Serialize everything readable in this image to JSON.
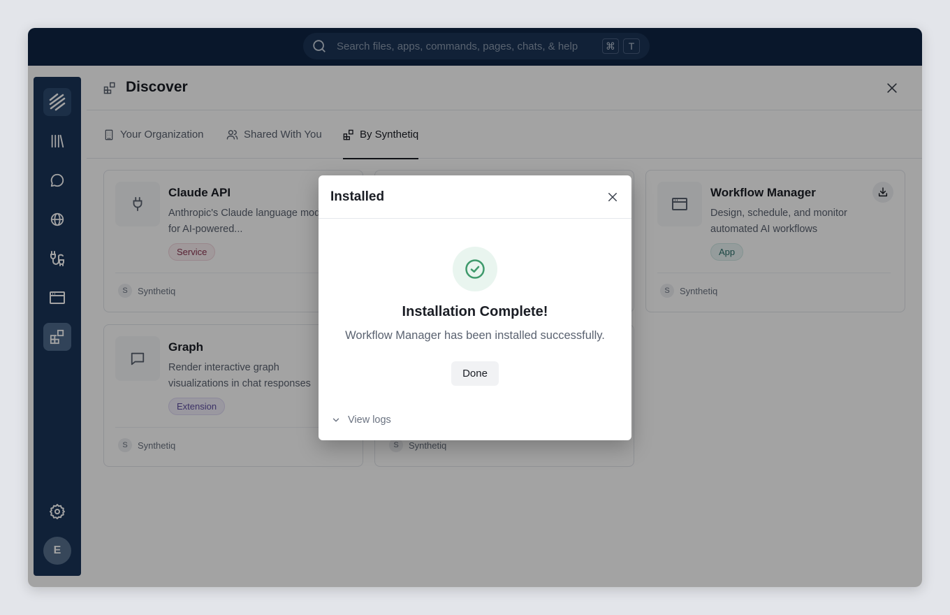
{
  "search": {
    "placeholder": "Search files, apps, commands, pages, chats, & help",
    "shortcut_keys": [
      "⌘",
      "T"
    ]
  },
  "sidebar": {
    "items": [
      {
        "name": "logo",
        "icon": "stripes-logo-icon"
      },
      {
        "name": "library",
        "icon": "library-icon"
      },
      {
        "name": "chats",
        "icon": "chat-bubble-icon"
      },
      {
        "name": "web",
        "icon": "globe-icon"
      },
      {
        "name": "integrations",
        "icon": "plug-cable-icon"
      },
      {
        "name": "apps",
        "icon": "window-icon"
      },
      {
        "name": "discover",
        "icon": "blocks-icon",
        "active": true
      }
    ],
    "settings_icon": "gear-icon",
    "avatar_initial": "E"
  },
  "header": {
    "title": "Discover"
  },
  "tabs": [
    {
      "label": "Your Organization",
      "icon": "building-icon"
    },
    {
      "label": "Shared With You",
      "icon": "users-icon"
    },
    {
      "label": "By Synthetiq",
      "icon": "blocks-icon",
      "active": true
    }
  ],
  "cards": [
    {
      "title": "Claude API",
      "description": "Anthropic's Claude language model for AI-powered...",
      "badge": "Service",
      "publisher_initial": "S",
      "publisher": "Synthetiq"
    },
    {
      "title": "Workflow Manager",
      "description": "Design, schedule, and monitor automated AI workflows",
      "badge": "App",
      "publisher_initial": "S",
      "publisher": "Synthetiq"
    },
    {
      "title": "Graph",
      "description": "Render interactive graph visualizations in chat responses",
      "badge": "Extension",
      "publisher_initial": "S",
      "publisher": "Synthetiq"
    },
    {
      "title": "",
      "description": "",
      "badge": "",
      "publisher_initial": "S",
      "publisher": "Synthetiq"
    }
  ],
  "modal": {
    "title": "Installed",
    "success_title": "Installation Complete!",
    "success_message": "Workflow Manager has been installed successfully.",
    "done_label": "Done",
    "view_logs_label": "View logs"
  },
  "colors": {
    "topbar": "#0f2544",
    "sidebar": "#1a3458",
    "success": "#3f9a6c"
  }
}
